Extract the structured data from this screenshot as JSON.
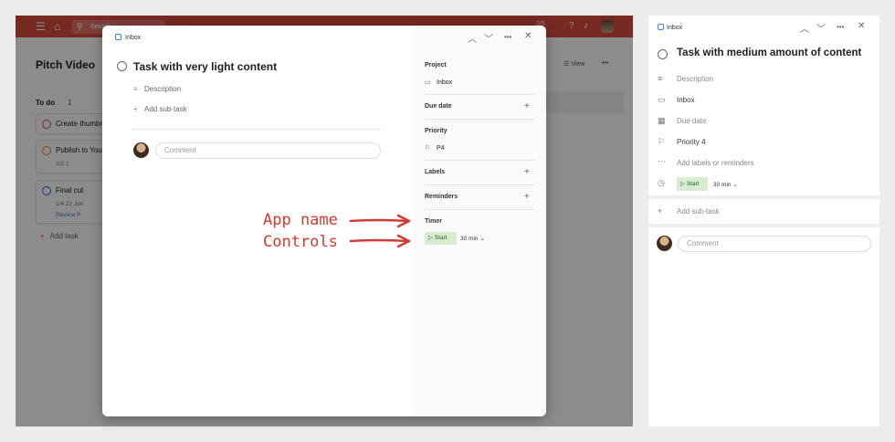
{
  "background_app": {
    "search_placeholder": "Search",
    "karma": "2/5",
    "project_title": "Pitch Video",
    "actions": {
      "view": "View"
    },
    "section": {
      "title": "To do",
      "count": "1"
    },
    "cards": [
      {
        "title": "Create thumbnail",
        "meta": ""
      },
      {
        "title": "Publish to YouTube",
        "meta": "1/2   1"
      },
      {
        "title": "Final cut",
        "meta": "1/4   22 Jan",
        "meta2": "Review   P"
      }
    ],
    "add_task": "Add task"
  },
  "modal": {
    "breadcrumb": "Inbox",
    "title": "Task with very light content",
    "description_placeholder": "Description",
    "add_subtask": "Add sub-task",
    "comment_placeholder": "Comment",
    "sidebar": {
      "project_label": "Project",
      "project_value": "Inbox",
      "due_date_label": "Due date",
      "priority_label": "Priority",
      "priority_value": "P4",
      "labels_label": "Labels",
      "reminders_label": "Reminders",
      "timer_label": "Timer",
      "start_label": "Start",
      "duration": "30 min"
    }
  },
  "annotations": {
    "first": "App name",
    "second": "Controls"
  },
  "right_panel": {
    "breadcrumb": "Inbox",
    "title": "Task with medium amount of content",
    "description_placeholder": "Description",
    "project": "Inbox",
    "due_date_placeholder": "Due date",
    "priority": "Priority 4",
    "labels_placeholder": "Add labels or reminders",
    "start_label": "Start",
    "duration": "30 min",
    "add_subtask": "Add sub-task",
    "comment_placeholder": "Comment"
  },
  "colors": {
    "brand_red": "#db4c3f",
    "annotation_red": "#d23b30",
    "start_green_bg": "#d8ecd2"
  }
}
